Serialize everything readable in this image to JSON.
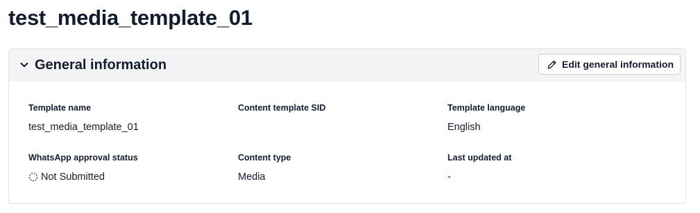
{
  "page": {
    "title": "test_media_template_01"
  },
  "general": {
    "section_title": "General information",
    "edit_label": "Edit general information",
    "fields": {
      "template_name": {
        "label": "Template name",
        "value": "test_media_template_01"
      },
      "content_sid": {
        "label": "Content template SID",
        "value": ""
      },
      "template_language": {
        "label": "Template language",
        "value": "English"
      },
      "approval_status": {
        "label": "WhatsApp approval status",
        "value": "Not Submitted",
        "icon": "status-not-submitted-icon"
      },
      "content_type": {
        "label": "Content type",
        "value": "Media"
      },
      "last_updated": {
        "label": "Last updated at",
        "value": "-"
      }
    }
  }
}
